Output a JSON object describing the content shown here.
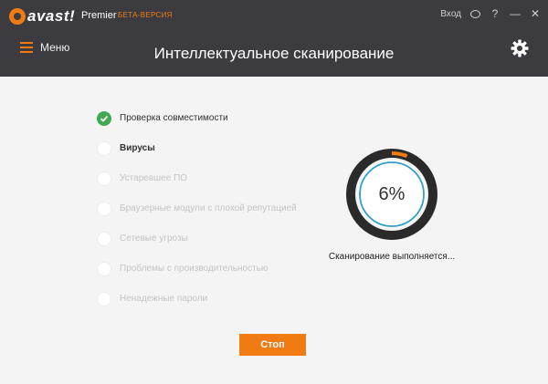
{
  "app": {
    "logo_text": "avast!",
    "product": "Premier",
    "beta": "БЕТА-ВЕРСИЯ",
    "signin": "Вход",
    "help": "?",
    "minimize": "—",
    "close": "✕"
  },
  "header": {
    "menu_label": "Меню",
    "title": "Интеллектуальное сканирование"
  },
  "steps": [
    {
      "label": "Проверка совместимости",
      "state": "done"
    },
    {
      "label": "Вирусы",
      "state": "active"
    },
    {
      "label": "Устаревшее ПО",
      "state": "pending"
    },
    {
      "label": "Браузерные модули с плохой репутацией",
      "state": "pending"
    },
    {
      "label": "Сетевые угрозы",
      "state": "pending"
    },
    {
      "label": "Проблемы с производительностью",
      "state": "pending"
    },
    {
      "label": "Ненадежные пароли",
      "state": "pending"
    }
  ],
  "scan": {
    "percent_text": "6%",
    "progress": 0.06,
    "status": "Сканирование выполняется..."
  },
  "stop_label": "Стоп",
  "colors": {
    "accent": "#f07b13",
    "header_bg": "#3b3b40",
    "done": "#42a853",
    "ring": "#2ea0c8"
  },
  "icons": [
    "avast-logo-icon",
    "chat-icon",
    "gear-icon",
    "hamburger-icon",
    "check-icon"
  ]
}
